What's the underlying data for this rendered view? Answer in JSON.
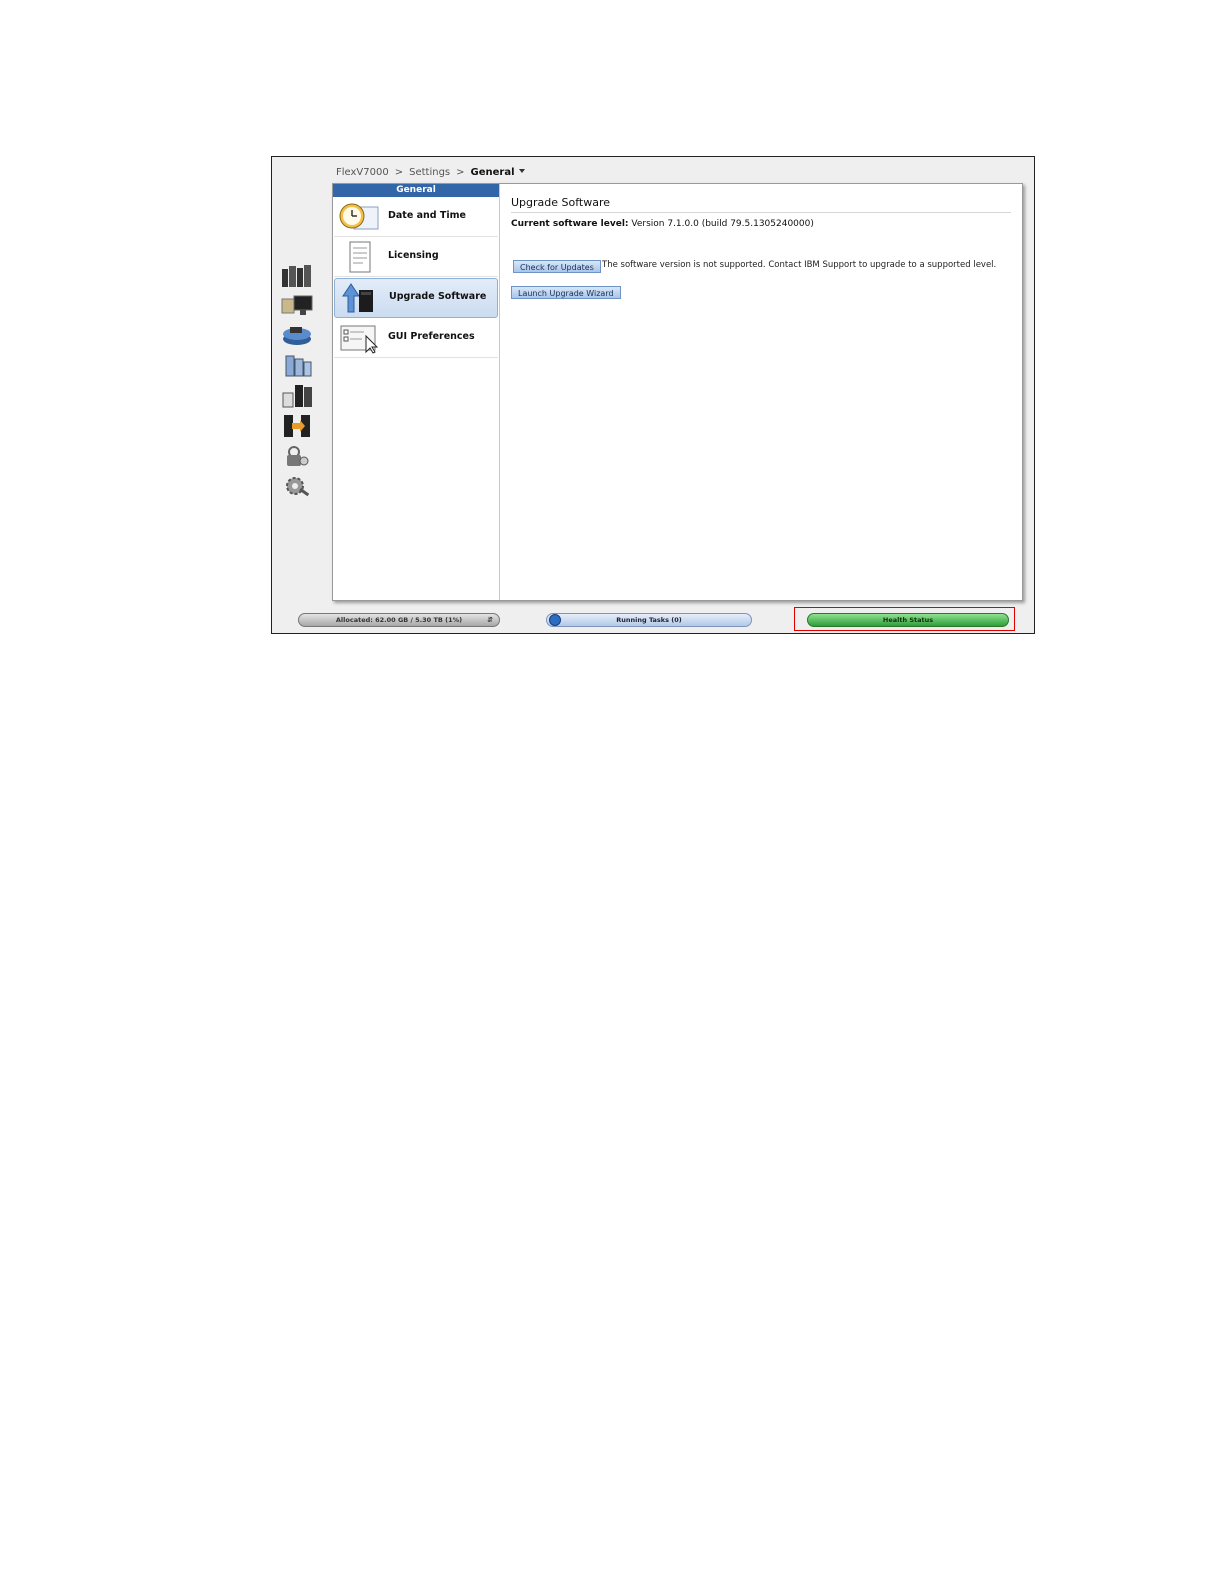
{
  "breadcrumb": {
    "root": "FlexV7000",
    "sep1": ">",
    "section": "Settings",
    "sep2": ">",
    "current": "General"
  },
  "left_rail": {
    "icons": [
      "home-icon",
      "monitoring-icon",
      "pools-icon",
      "volumes-icon",
      "hosts-icon",
      "copy-services-icon",
      "access-icon",
      "settings-icon"
    ]
  },
  "sidebar": {
    "header": "General",
    "items": [
      {
        "label": "Date and Time",
        "icon": "clock-icon",
        "active": false
      },
      {
        "label": "Licensing",
        "icon": "license-document-icon",
        "active": false
      },
      {
        "label": "Upgrade Software",
        "icon": "upgrade-arrow-icon",
        "active": true
      },
      {
        "label": "GUI Preferences",
        "icon": "preferences-form-icon",
        "active": false
      }
    ]
  },
  "main": {
    "title": "Upgrade Software",
    "level_label": "Current software level:",
    "level_value": "Version 7.1.0.0 (build 79.5.1305240000)",
    "check_button": "Check for Updates",
    "message": "The software version is not supported. Contact IBM Support to upgrade to a supported level.",
    "wizard_button": "Launch Upgrade Wizard"
  },
  "status_bar": {
    "allocated": "Allocated: 62.00 GB / 5.30 TB (1%)",
    "tasks": "Running Tasks (0)",
    "health": "Health Status"
  },
  "colors": {
    "accent": "#3366a8",
    "health": "#3cb043",
    "highlight": "#e00000"
  }
}
